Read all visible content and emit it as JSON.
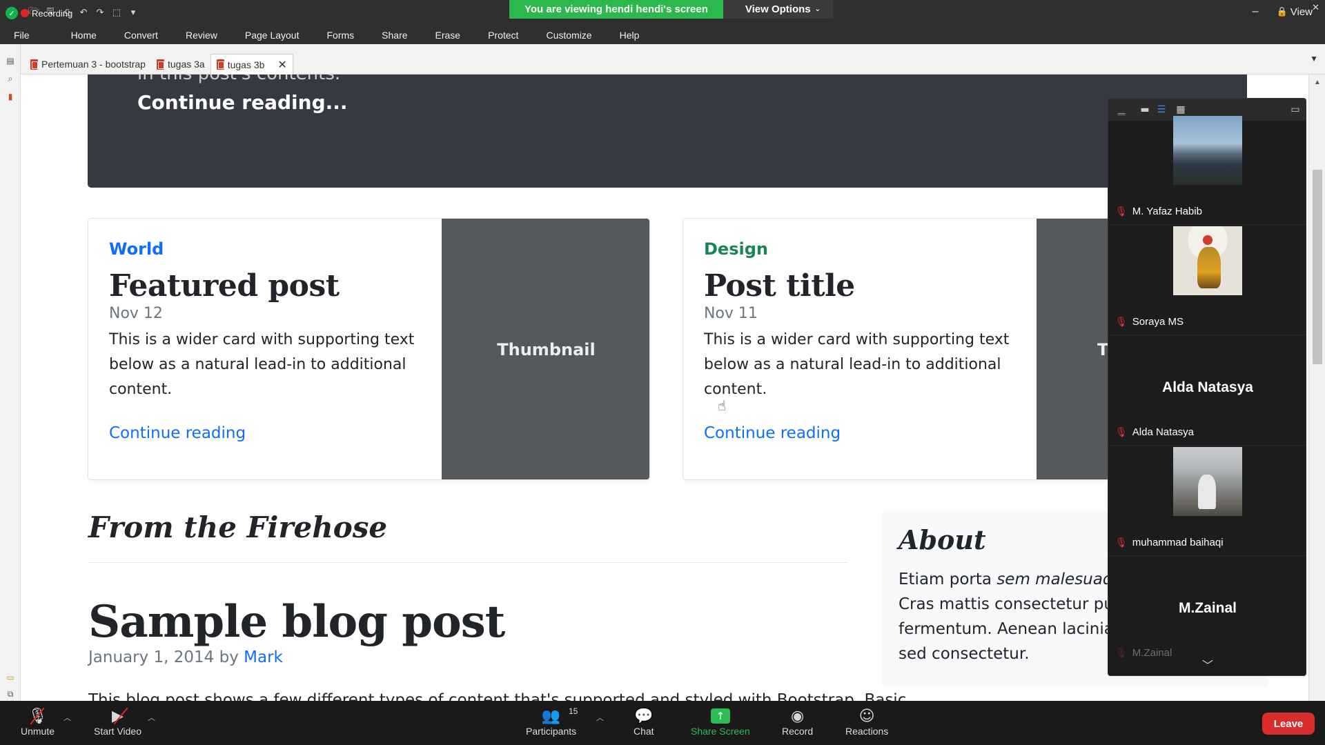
{
  "app": {
    "recording_label": "Recording",
    "menu": [
      "File",
      "Home",
      "Convert",
      "Review",
      "Page Layout",
      "Forms",
      "Share",
      "Erase",
      "Protect",
      "Customize",
      "Help"
    ],
    "view_label": "View",
    "tabs": [
      {
        "label": "Pertemuan 3 - bootstrap",
        "active": false
      },
      {
        "label": "tugas 3a",
        "active": false
      },
      {
        "label": "tugas 3b",
        "active": true
      }
    ]
  },
  "share_banner": {
    "viewing_text": "You are viewing hendi hendi's screen",
    "view_options": "View Options"
  },
  "page": {
    "hero_fragment": "in this post's contents.",
    "hero_continue": "Continue reading...",
    "cards": [
      {
        "category": "World",
        "title": "Featured post",
        "date": "Nov 12",
        "text": "This is a wider card with supporting text below as a natural lead-in to additional content.",
        "link": "Continue reading",
        "thumb": "Thumbnail"
      },
      {
        "category": "Design",
        "title": "Post title",
        "date": "Nov 11",
        "text": "This is a wider card with supporting text below as a natural lead-in to additional content.",
        "link": "Continue reading",
        "thumb": "T"
      }
    ],
    "firehose_heading": "From the Firehose",
    "post_title": "Sample blog post",
    "post_meta_date": "January 1, 2014 by",
    "post_meta_author": "Mark",
    "post_cut_line": "This blog post shows a few different types of content that's supported and styled with Bootstrap. Basic",
    "about_heading": "About",
    "about_text_pre": "Etiam porta ",
    "about_text_em": "sem malesuada m",
    "about_text_post": "euismod. Cras mattis consectetur purus sit amet fermentum. Aenean lacinia bibendum nulla sed consectetur."
  },
  "participants": [
    {
      "name": "M. Yafaz Habib",
      "display": "photo",
      "muted": true
    },
    {
      "name": "Soraya MS",
      "display": "photo",
      "muted": true
    },
    {
      "name": "Alda Natasya",
      "display": "name",
      "muted": true
    },
    {
      "name": "muhammad baihaqi",
      "display": "photo",
      "muted": true
    },
    {
      "name": "M.Zainal",
      "display": "name",
      "muted": true
    }
  ],
  "controls": {
    "unmute": "Unmute",
    "start_video": "Start Video",
    "participants": "Participants",
    "participants_count": "15",
    "chat": "Chat",
    "share_screen": "Share Screen",
    "record": "Record",
    "reactions": "Reactions",
    "leave": "Leave"
  },
  "colors": {
    "banner_green": "#2db84e",
    "leave_red": "#d92d2d",
    "link_blue": "#0d6efd",
    "design_green": "#198754",
    "hero_bg": "#353a42",
    "thumb_bg": "#55595c"
  }
}
